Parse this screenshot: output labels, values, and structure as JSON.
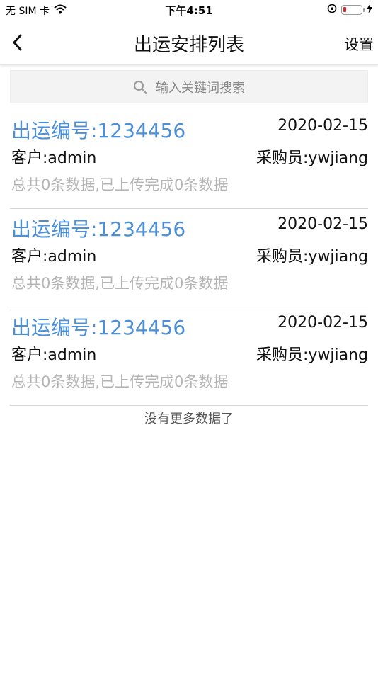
{
  "status": {
    "carrier": "无 SIM 卡",
    "time": "下午4:51"
  },
  "nav": {
    "title": "出运安排列表",
    "right_label": "设置"
  },
  "search": {
    "placeholder": "输入关键词搜索"
  },
  "items": [
    {
      "shipment_no": "出运编号:1234456",
      "date": "2020-02-15",
      "customer": "客户:admin",
      "buyer": "采购员:ywjiang",
      "summary": "总共0条数据,已上传完成0条数据"
    },
    {
      "shipment_no": "出运编号:1234456",
      "date": "2020-02-15",
      "customer": "客户:admin",
      "buyer": "采购员:ywjiang",
      "summary": "总共0条数据,已上传完成0条数据"
    },
    {
      "shipment_no": "出运编号:1234456",
      "date": "2020-02-15",
      "customer": "客户:admin",
      "buyer": "采购员:ywjiang",
      "summary": "总共0条数据,已上传完成0条数据"
    }
  ],
  "footer": {
    "no_more": "没有更多数据了"
  },
  "colors": {
    "link_blue": "#4a8fd7",
    "muted_gray": "#b5b5b5",
    "battery_red": "#e0242b"
  }
}
